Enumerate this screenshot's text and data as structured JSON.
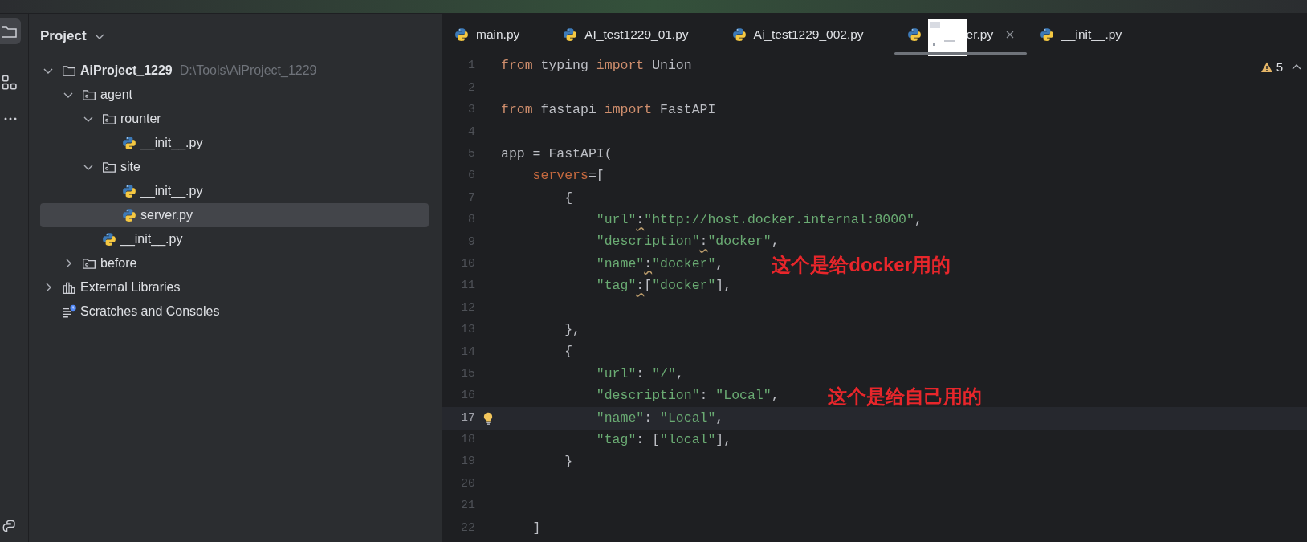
{
  "tool_strip": [
    {
      "kind": "project",
      "selected": true
    },
    {
      "kind": "structure",
      "selected": false
    },
    {
      "kind": "more",
      "selected": false
    },
    {
      "kind": "python",
      "selected": false
    }
  ],
  "sidebar": {
    "title": "Project",
    "tree": [
      {
        "label": "AiProject_1229",
        "kind": "project",
        "path": "D:\\Tools\\AiProject_1229",
        "expanded": true,
        "selected": false,
        "children": [
          {
            "label": "agent",
            "kind": "package",
            "expanded": true,
            "selected": false,
            "children": [
              {
                "label": "rounter",
                "kind": "package",
                "expanded": true,
                "selected": false,
                "children": [
                  {
                    "label": "__init__.py",
                    "kind": "python",
                    "selected": false
                  }
                ]
              },
              {
                "label": "site",
                "kind": "package",
                "expanded": true,
                "selected": false,
                "children": [
                  {
                    "label": "__init__.py",
                    "kind": "python",
                    "selected": false
                  },
                  {
                    "label": "server.py",
                    "kind": "python",
                    "selected": true
                  }
                ]
              },
              {
                "label": "__init__.py",
                "kind": "python",
                "selected": false
              }
            ]
          },
          {
            "label": "before",
            "kind": "package",
            "expanded": false,
            "selected": false
          }
        ]
      },
      {
        "label": "External Libraries",
        "kind": "libraries",
        "expanded": false,
        "selected": false
      },
      {
        "label": "Scratches and Consoles",
        "kind": "scratches",
        "selected": false
      }
    ]
  },
  "tabs": [
    {
      "label": "main.py",
      "selected": false
    },
    {
      "label": "AI_test1229_01.py",
      "selected": false
    },
    {
      "label": "Ai_test1229_002.py",
      "selected": false
    },
    {
      "label": "er.py",
      "selected": true,
      "covered": true
    },
    {
      "label": "__init__.py",
      "selected": false
    }
  ],
  "editor": {
    "problems": "5",
    "lines": [
      {
        "number": "1",
        "current": false,
        "tokens": [
          {
            "kind": "keyword",
            "text": "from"
          },
          {
            "kind": "plain",
            "text": " typing "
          },
          {
            "kind": "keyword",
            "text": "import"
          },
          {
            "kind": "plain",
            "text": " Union"
          }
        ]
      },
      {
        "number": "2",
        "current": false
      },
      {
        "number": "3",
        "current": false,
        "tokens": [
          {
            "kind": "keyword",
            "text": "from"
          },
          {
            "kind": "plain",
            "text": " fastapi "
          },
          {
            "kind": "keyword",
            "text": "import"
          },
          {
            "kind": "plain",
            "text": " FastAPI"
          }
        ]
      },
      {
        "number": "4",
        "current": false
      },
      {
        "number": "5",
        "current": false,
        "tokens": [
          {
            "kind": "plain",
            "text": "app = FastAPI("
          }
        ]
      },
      {
        "number": "6",
        "current": false,
        "tokens": [
          {
            "kind": "param",
            "text": "    servers"
          },
          {
            "kind": "plain",
            "text": "=["
          }
        ]
      },
      {
        "number": "7",
        "current": false,
        "tokens": [
          {
            "kind": "plain",
            "text": "        {"
          }
        ]
      },
      {
        "number": "8",
        "current": false,
        "tokens": [
          {
            "kind": "string",
            "text": "            \"url\""
          },
          {
            "kind": "warn",
            "text": ":"
          },
          {
            "kind": "string",
            "text": "\""
          },
          {
            "kind": "link",
            "text": "http://host.docker.internal:8000"
          },
          {
            "kind": "string",
            "text": "\""
          },
          {
            "kind": "plain",
            "text": ","
          }
        ]
      },
      {
        "number": "9",
        "current": false,
        "tokens": [
          {
            "kind": "string",
            "text": "            \"description\""
          },
          {
            "kind": "warn",
            "text": ":"
          },
          {
            "kind": "string",
            "text": "\"docker\""
          },
          {
            "kind": "plain",
            "text": ","
          }
        ]
      },
      {
        "number": "10",
        "current": false,
        "note": "这个是给docker用的",
        "tokens": [
          {
            "kind": "string",
            "text": "            \"name\""
          },
          {
            "kind": "warn",
            "text": ":"
          },
          {
            "kind": "string",
            "text": "\"docker\""
          },
          {
            "kind": "plain",
            "text": ","
          }
        ]
      },
      {
        "number": "11",
        "current": false,
        "tokens": [
          {
            "kind": "string",
            "text": "            \"tag\""
          },
          {
            "kind": "warn",
            "text": ":"
          },
          {
            "kind": "plain",
            "text": "["
          },
          {
            "kind": "string",
            "text": "\"docker\""
          },
          {
            "kind": "plain",
            "text": "],"
          }
        ]
      },
      {
        "number": "12",
        "current": false
      },
      {
        "number": "13",
        "current": false,
        "tokens": [
          {
            "kind": "plain",
            "text": "        },"
          }
        ]
      },
      {
        "number": "14",
        "current": false,
        "tokens": [
          {
            "kind": "plain",
            "text": "        {"
          }
        ]
      },
      {
        "number": "15",
        "current": false,
        "tokens": [
          {
            "kind": "string",
            "text": "            \"url\""
          },
          {
            "kind": "plain",
            "text": ": "
          },
          {
            "kind": "string",
            "text": "\"/\""
          },
          {
            "kind": "plain",
            "text": ","
          }
        ]
      },
      {
        "number": "16",
        "current": false,
        "note": "这个是给自己用的",
        "tokens": [
          {
            "kind": "string",
            "text": "            \"description\""
          },
          {
            "kind": "plain",
            "text": ": "
          },
          {
            "kind": "string",
            "text": "\"Local\""
          },
          {
            "kind": "plain",
            "text": ","
          }
        ]
      },
      {
        "number": "17",
        "current": true,
        "tokens": [
          {
            "kind": "string",
            "text": "            \"name\""
          },
          {
            "kind": "plain",
            "text": ": "
          },
          {
            "kind": "string",
            "text": "\"Local\""
          },
          {
            "kind": "plain",
            "text": ","
          }
        ]
      },
      {
        "number": "18",
        "current": false,
        "tokens": [
          {
            "kind": "string",
            "text": "            \"tag\""
          },
          {
            "kind": "plain",
            "text": ": ["
          },
          {
            "kind": "string",
            "text": "\"local\""
          },
          {
            "kind": "plain",
            "text": "],"
          }
        ]
      },
      {
        "number": "19",
        "current": false,
        "tokens": [
          {
            "kind": "plain",
            "text": "        }"
          }
        ]
      },
      {
        "number": "20",
        "current": false
      },
      {
        "number": "21",
        "current": false
      },
      {
        "number": "22",
        "current": false,
        "tokens": [
          {
            "kind": "plain",
            "text": "    ]"
          }
        ]
      }
    ]
  }
}
